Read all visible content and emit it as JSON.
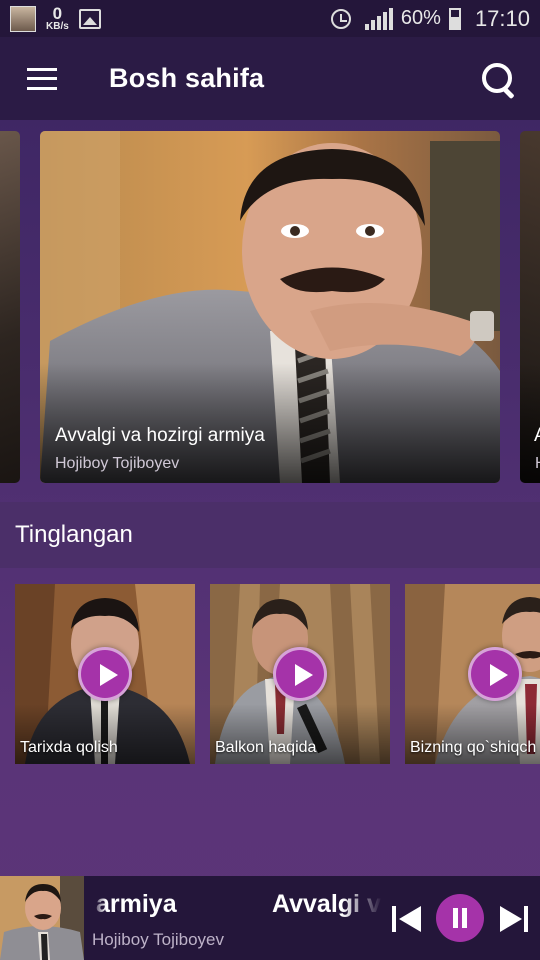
{
  "status_bar": {
    "net_speed": "0",
    "net_unit": "KB/s",
    "battery": "60%",
    "time": "17:10"
  },
  "toolbar": {
    "title": "Bosh sahifa",
    "menu_icon": "hamburger-menu-icon",
    "search_icon": "search-icon"
  },
  "featured": {
    "title": "Avvalgi va hozirgi armiya",
    "artist": "Hojiboy Tojiboyev",
    "next_title_partial": "A",
    "next_artist_partial": "H"
  },
  "section": {
    "title": "Tinglangan"
  },
  "tiles": [
    {
      "label": "Tarixda qolish"
    },
    {
      "label": "Balkon haqida"
    },
    {
      "label": "Bizning qo`shiqch"
    }
  ],
  "player": {
    "title_scroll_a": "armiya",
    "title_scroll_b": "Avvalgi va",
    "artist": "Hojiboy Tojiboyev"
  },
  "colors": {
    "accent": "#a533a9",
    "toolbar_bg": "#2b1b45",
    "page_bg": "#4a2d6e"
  }
}
